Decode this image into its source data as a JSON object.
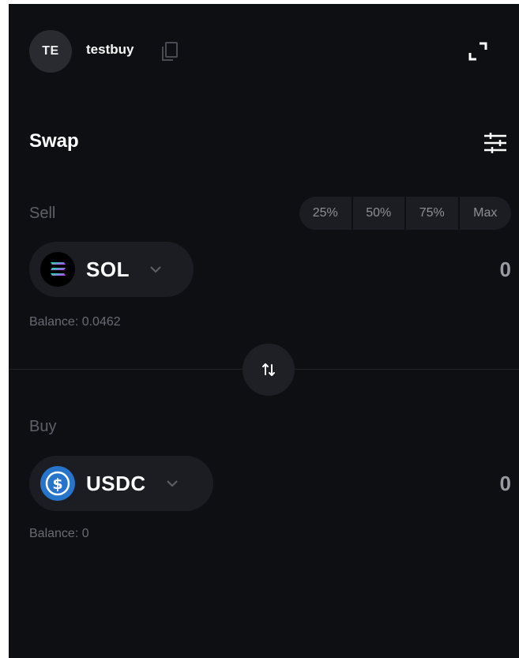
{
  "header": {
    "avatar_initials": "TE",
    "username": "testbuy"
  },
  "swap": {
    "title": "Swap"
  },
  "sell": {
    "label": "Sell",
    "percent_buttons": [
      "25%",
      "50%",
      "75%",
      "Max"
    ],
    "token": "SOL",
    "amount": "0",
    "balance": "Balance: 0.0462"
  },
  "buy": {
    "label": "Buy",
    "token": "USDC",
    "amount": "0",
    "balance": "Balance: 0"
  },
  "icons": {
    "copy": "copy-icon",
    "expand": "expand-icon",
    "settings": "sliders-icon",
    "swap": "swap-arrows-icon",
    "chevron": "chevron-down-icon"
  },
  "colors": {
    "background": "#0e0f13",
    "surface": "#1c1d22",
    "usdc_blue": "#2775ca"
  }
}
